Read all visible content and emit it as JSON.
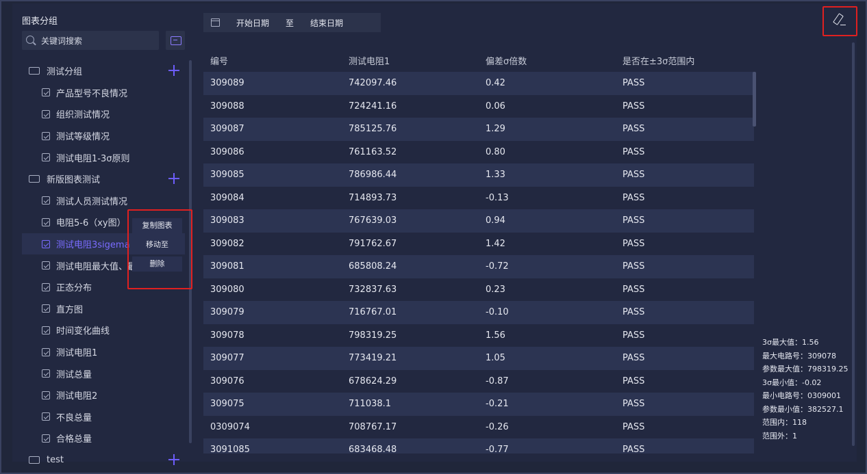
{
  "sidebar": {
    "title": "图表分组",
    "search_placeholder": "关键词搜索",
    "groups": [
      {
        "name": "测试分组",
        "items": [
          "产品型号不良情况",
          "组织测试情况",
          "测试等级情况",
          "测试电阻1-3σ原则"
        ]
      },
      {
        "name": "新版图表测试",
        "items": [
          "测试人员测试情况",
          "电阻5-6（xy图）",
          "测试电阻3sigema",
          "测试电阻最大值、最小值",
          "正态分布",
          "直方图",
          "时间变化曲线",
          "测试电阻1",
          "测试总量",
          "测试电阻2",
          "不良总量",
          "合格总量"
        ]
      },
      {
        "name": "test",
        "items": []
      }
    ],
    "active_item": "测试电阻3sigema"
  },
  "context_menu": [
    "复制图表",
    "移动至",
    "删除"
  ],
  "date_filter": {
    "start": "开始日期",
    "separator": "至",
    "end": "结束日期"
  },
  "table": {
    "headers": [
      "编号",
      "测试电阻1",
      "偏差σ倍数",
      "是否在±3σ范围内"
    ],
    "rows": [
      [
        "309089",
        "742097.46",
        "0.42",
        "PASS"
      ],
      [
        "309088",
        "724241.16",
        "0.06",
        "PASS"
      ],
      [
        "309087",
        "785125.76",
        "1.29",
        "PASS"
      ],
      [
        "309086",
        "761163.52",
        "0.80",
        "PASS"
      ],
      [
        "309085",
        "786986.44",
        "1.33",
        "PASS"
      ],
      [
        "309084",
        "714893.73",
        "-0.13",
        "PASS"
      ],
      [
        "309083",
        "767639.03",
        "0.94",
        "PASS"
      ],
      [
        "309082",
        "791762.67",
        "1.42",
        "PASS"
      ],
      [
        "309081",
        "685808.24",
        "-0.72",
        "PASS"
      ],
      [
        "309080",
        "732837.63",
        "0.23",
        "PASS"
      ],
      [
        "309079",
        "716767.01",
        "-0.10",
        "PASS"
      ],
      [
        "309078",
        "798319.25",
        "1.56",
        "PASS"
      ],
      [
        "309077",
        "773419.21",
        "1.05",
        "PASS"
      ],
      [
        "309076",
        "678624.29",
        "-0.87",
        "PASS"
      ],
      [
        "309075",
        "711038.1",
        "-0.21",
        "PASS"
      ],
      [
        "0309074",
        "708767.17",
        "-0.26",
        "PASS"
      ],
      [
        "3091085",
        "683468.48",
        "-0.77",
        "PASS"
      ]
    ]
  },
  "stats": [
    "3σ最大值：1.56",
    "最大电路号：309078",
    "参数最大值：798319.25",
    "3σ最小值：-0.02",
    "最小电路号：0309001",
    "参数最小值：382527.1",
    "范围内：118",
    "范围外：1"
  ],
  "colors": {
    "accent": "#6d5dfc",
    "highlight_frame": "#e02020",
    "background": "#222840"
  }
}
